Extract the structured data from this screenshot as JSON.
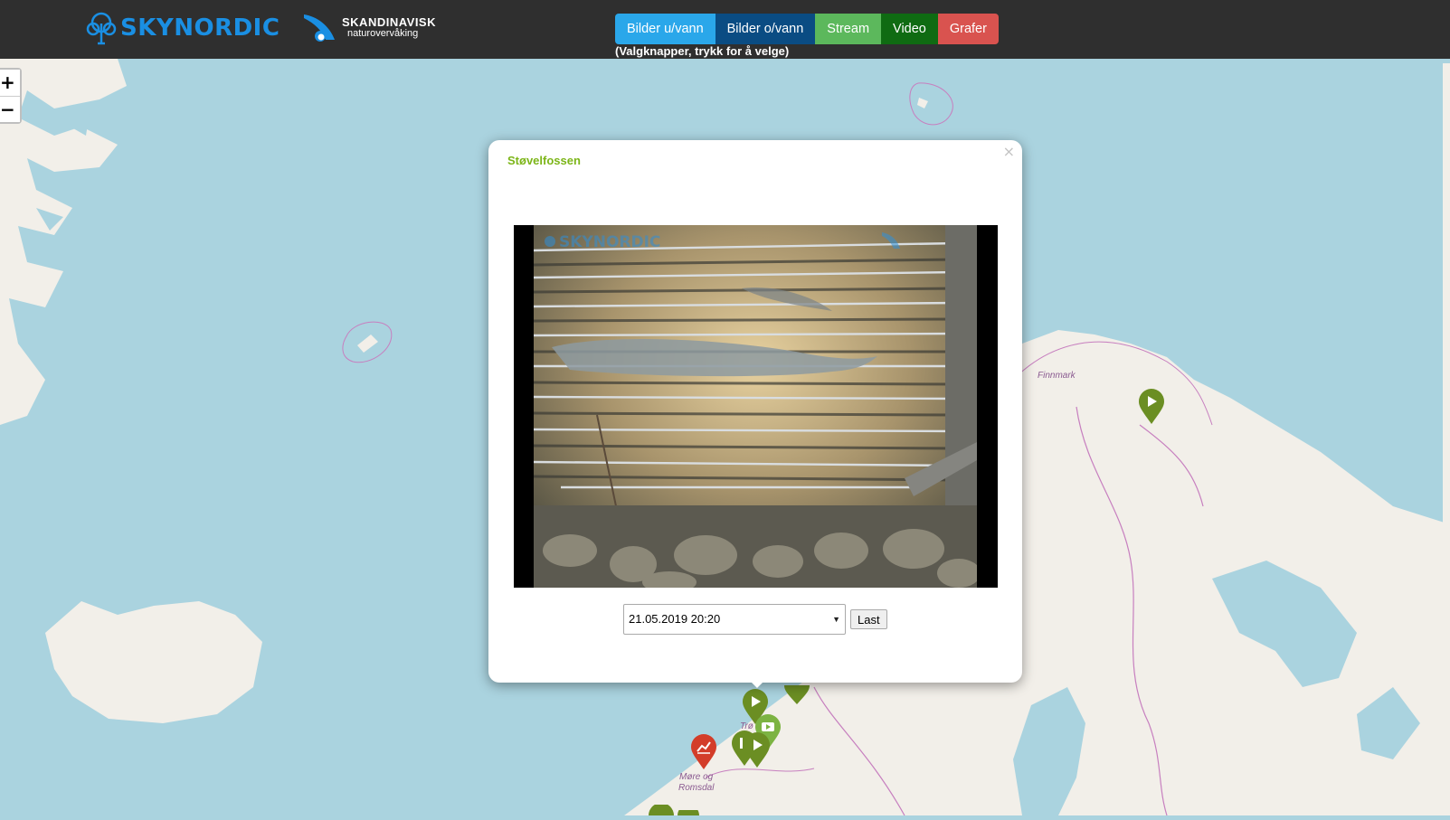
{
  "header": {
    "logo_primary": "SKYNORDIC",
    "logo_secondary_line1": "SKANDINAVISK",
    "logo_secondary_line2": "naturovervåking",
    "buttons": [
      {
        "label": "Bilder u/vann",
        "color": "#2aa7ea"
      },
      {
        "label": "Bilder o/vann",
        "color": "#0a4c83"
      },
      {
        "label": "Stream",
        "color": "#5cb85c"
      },
      {
        "label": "Video",
        "color": "#0f6b12"
      },
      {
        "label": "Grafer",
        "color": "#d9534f"
      }
    ],
    "hint": "(Valgknapper, trykk for å velge)"
  },
  "map": {
    "zoom_in": "+",
    "zoom_out": "−",
    "labels": {
      "finnmark": "Finnmark",
      "trondelag": "Trø",
      "more_1": "Møre og",
      "more_2": "Romsdal"
    },
    "colors": {
      "sea": "#aad3df",
      "land": "#f2efe9",
      "border": "#c77fbf",
      "marker_green": "#6b8e23",
      "marker_red": "#d33d29"
    }
  },
  "popup": {
    "title": "Støvelfossen",
    "close_glyph": "×",
    "image_watermark": "SKYNORDIC",
    "select_value": "21.05.2019 20:20",
    "select_arrow": "▼",
    "load_button": "Last"
  }
}
